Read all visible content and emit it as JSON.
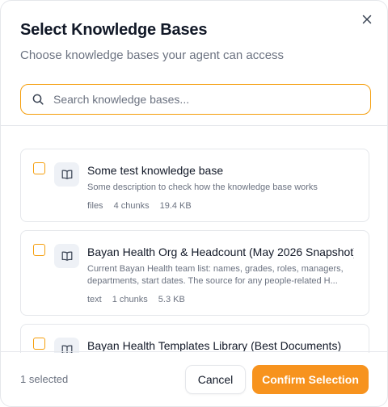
{
  "dialog": {
    "title": "Select Knowledge Bases",
    "subtitle": "Choose knowledge bases your agent can access",
    "close_icon": "close-icon"
  },
  "search": {
    "placeholder": "Search knowledge bases...",
    "value": "",
    "icon": "search-icon"
  },
  "knowledge_bases": [
    {
      "name": "Some test knowledge base",
      "description": "Some description to check how the knowledge base works",
      "type": "files",
      "chunks": "4 chunks",
      "size": "19.4 KB",
      "checked": false,
      "icon": "book-icon"
    },
    {
      "name": "Bayan Health Org & Headcount (May 2026 Snapshot)",
      "description": "Current Bayan Health team list: names, grades, roles, managers, departments, start dates. The source for any people-related H...",
      "type": "text",
      "chunks": "1 chunks",
      "size": "5.3 KB",
      "checked": false,
      "icon": "book-icon"
    },
    {
      "name": "Bayan Health Templates Library (Best Documents)",
      "checked": false,
      "icon": "book-icon"
    }
  ],
  "footer": {
    "selected_text": "1 selected",
    "cancel_label": "Cancel",
    "confirm_label": "Confirm Selection"
  },
  "colors": {
    "accent": "#f7931e",
    "border_accent": "#f59e0b",
    "muted_text": "#6b7280"
  }
}
